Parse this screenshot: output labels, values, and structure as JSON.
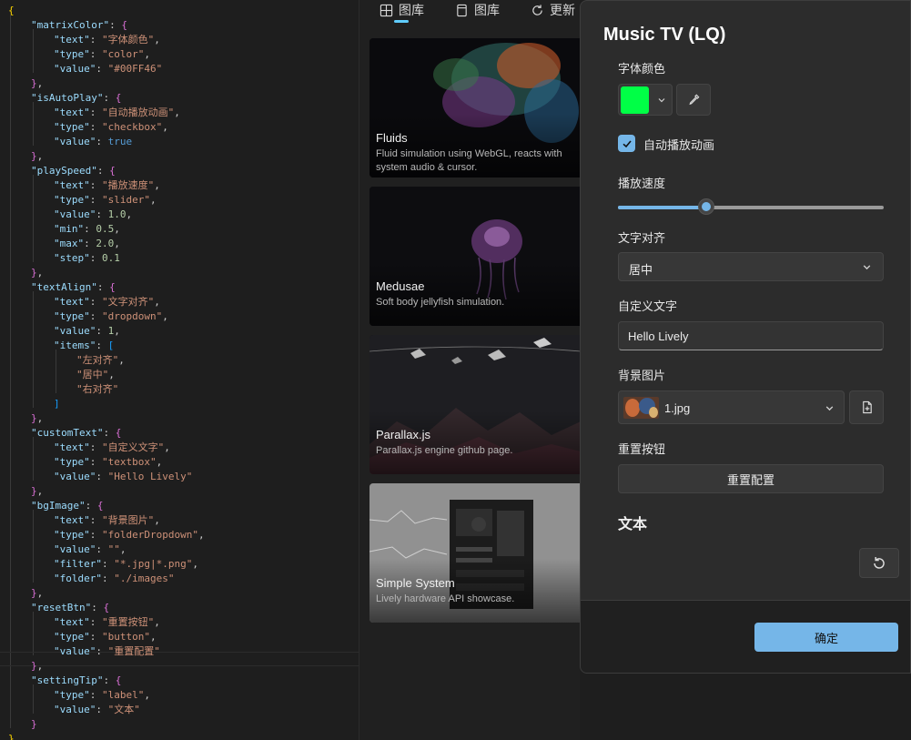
{
  "code": {
    "lines": [
      {
        "indent": 0,
        "parts": [
          [
            "br1",
            "{"
          ]
        ]
      },
      {
        "indent": 1,
        "parts": [
          [
            "k",
            "\"matrixColor\""
          ],
          [
            "p",
            ": "
          ],
          [
            "br2",
            "{"
          ]
        ]
      },
      {
        "indent": 2,
        "parts": [
          [
            "k",
            "\"text\""
          ],
          [
            "p",
            ": "
          ],
          [
            "s",
            "\"字体颜色\""
          ],
          [
            "p",
            ","
          ]
        ]
      },
      {
        "indent": 2,
        "parts": [
          [
            "k",
            "\"type\""
          ],
          [
            "p",
            ": "
          ],
          [
            "s",
            "\"color\""
          ],
          [
            "p",
            ","
          ]
        ]
      },
      {
        "indent": 2,
        "parts": [
          [
            "k",
            "\"value\""
          ],
          [
            "p",
            ": "
          ],
          [
            "s",
            "\"#00FF46\""
          ]
        ]
      },
      {
        "indent": 1,
        "parts": [
          [
            "br2",
            "}"
          ],
          [
            "p",
            ","
          ]
        ]
      },
      {
        "indent": 1,
        "parts": [
          [
            "k",
            "\"isAutoPlay\""
          ],
          [
            "p",
            ": "
          ],
          [
            "br2",
            "{"
          ]
        ]
      },
      {
        "indent": 2,
        "parts": [
          [
            "k",
            "\"text\""
          ],
          [
            "p",
            ": "
          ],
          [
            "s",
            "\"自动播放动画\""
          ],
          [
            "p",
            ","
          ]
        ]
      },
      {
        "indent": 2,
        "parts": [
          [
            "k",
            "\"type\""
          ],
          [
            "p",
            ": "
          ],
          [
            "s",
            "\"checkbox\""
          ],
          [
            "p",
            ","
          ]
        ]
      },
      {
        "indent": 2,
        "parts": [
          [
            "k",
            "\"value\""
          ],
          [
            "p",
            ": "
          ],
          [
            "b",
            "true"
          ]
        ]
      },
      {
        "indent": 1,
        "parts": [
          [
            "br2",
            "}"
          ],
          [
            "p",
            ","
          ]
        ]
      },
      {
        "indent": 1,
        "parts": [
          [
            "k",
            "\"playSpeed\""
          ],
          [
            "p",
            ": "
          ],
          [
            "br2",
            "{"
          ]
        ]
      },
      {
        "indent": 2,
        "parts": [
          [
            "k",
            "\"text\""
          ],
          [
            "p",
            ": "
          ],
          [
            "s",
            "\"播放速度\""
          ],
          [
            "p",
            ","
          ]
        ]
      },
      {
        "indent": 2,
        "parts": [
          [
            "k",
            "\"type\""
          ],
          [
            "p",
            ": "
          ],
          [
            "s",
            "\"slider\""
          ],
          [
            "p",
            ","
          ]
        ]
      },
      {
        "indent": 2,
        "parts": [
          [
            "k",
            "\"value\""
          ],
          [
            "p",
            ": "
          ],
          [
            "n",
            "1.0"
          ],
          [
            "p",
            ","
          ]
        ]
      },
      {
        "indent": 2,
        "parts": [
          [
            "k",
            "\"min\""
          ],
          [
            "p",
            ": "
          ],
          [
            "n",
            "0.5"
          ],
          [
            "p",
            ","
          ]
        ]
      },
      {
        "indent": 2,
        "parts": [
          [
            "k",
            "\"max\""
          ],
          [
            "p",
            ": "
          ],
          [
            "n",
            "2.0"
          ],
          [
            "p",
            ","
          ]
        ]
      },
      {
        "indent": 2,
        "parts": [
          [
            "k",
            "\"step\""
          ],
          [
            "p",
            ": "
          ],
          [
            "n",
            "0.1"
          ]
        ]
      },
      {
        "indent": 1,
        "parts": [
          [
            "br2",
            "}"
          ],
          [
            "p",
            ","
          ]
        ]
      },
      {
        "indent": 1,
        "parts": [
          [
            "k",
            "\"textAlign\""
          ],
          [
            "p",
            ": "
          ],
          [
            "br2",
            "{"
          ]
        ]
      },
      {
        "indent": 2,
        "parts": [
          [
            "k",
            "\"text\""
          ],
          [
            "p",
            ": "
          ],
          [
            "s",
            "\"文字对齐\""
          ],
          [
            "p",
            ","
          ]
        ]
      },
      {
        "indent": 2,
        "parts": [
          [
            "k",
            "\"type\""
          ],
          [
            "p",
            ": "
          ],
          [
            "s",
            "\"dropdown\""
          ],
          [
            "p",
            ","
          ]
        ]
      },
      {
        "indent": 2,
        "parts": [
          [
            "k",
            "\"value\""
          ],
          [
            "p",
            ": "
          ],
          [
            "n",
            "1"
          ],
          [
            "p",
            ","
          ]
        ]
      },
      {
        "indent": 2,
        "parts": [
          [
            "k",
            "\"items\""
          ],
          [
            "p",
            ": "
          ],
          [
            "br3",
            "["
          ]
        ]
      },
      {
        "indent": 3,
        "parts": [
          [
            "s",
            "\"左对齐\""
          ],
          [
            "p",
            ","
          ]
        ]
      },
      {
        "indent": 3,
        "parts": [
          [
            "s",
            "\"居中\""
          ],
          [
            "p",
            ","
          ]
        ]
      },
      {
        "indent": 3,
        "parts": [
          [
            "s",
            "\"右对齐\""
          ]
        ]
      },
      {
        "indent": 2,
        "parts": [
          [
            "br3",
            "]"
          ]
        ]
      },
      {
        "indent": 1,
        "parts": [
          [
            "br2",
            "}"
          ],
          [
            "p",
            ","
          ]
        ]
      },
      {
        "indent": 1,
        "parts": [
          [
            "k",
            "\"customText\""
          ],
          [
            "p",
            ": "
          ],
          [
            "br2",
            "{"
          ]
        ]
      },
      {
        "indent": 2,
        "parts": [
          [
            "k",
            "\"text\""
          ],
          [
            "p",
            ": "
          ],
          [
            "s",
            "\"自定义文字\""
          ],
          [
            "p",
            ","
          ]
        ]
      },
      {
        "indent": 2,
        "parts": [
          [
            "k",
            "\"type\""
          ],
          [
            "p",
            ": "
          ],
          [
            "s",
            "\"textbox\""
          ],
          [
            "p",
            ","
          ]
        ]
      },
      {
        "indent": 2,
        "parts": [
          [
            "k",
            "\"value\""
          ],
          [
            "p",
            ": "
          ],
          [
            "s",
            "\"Hello Lively\""
          ]
        ]
      },
      {
        "indent": 1,
        "parts": [
          [
            "br2",
            "}"
          ],
          [
            "p",
            ","
          ]
        ]
      },
      {
        "indent": 1,
        "parts": [
          [
            "k",
            "\"bgImage\""
          ],
          [
            "p",
            ": "
          ],
          [
            "br2",
            "{"
          ]
        ]
      },
      {
        "indent": 2,
        "parts": [
          [
            "k",
            "\"text\""
          ],
          [
            "p",
            ": "
          ],
          [
            "s",
            "\"背景图片\""
          ],
          [
            "p",
            ","
          ]
        ]
      },
      {
        "indent": 2,
        "parts": [
          [
            "k",
            "\"type\""
          ],
          [
            "p",
            ": "
          ],
          [
            "s",
            "\"folderDropdown\""
          ],
          [
            "p",
            ","
          ]
        ]
      },
      {
        "indent": 2,
        "parts": [
          [
            "k",
            "\"value\""
          ],
          [
            "p",
            ": "
          ],
          [
            "s",
            "\"\""
          ],
          [
            "p",
            ","
          ]
        ]
      },
      {
        "indent": 2,
        "parts": [
          [
            "k",
            "\"filter\""
          ],
          [
            "p",
            ": "
          ],
          [
            "s",
            "\"*.jpg|*.png\""
          ],
          [
            "p",
            ","
          ]
        ]
      },
      {
        "indent": 2,
        "parts": [
          [
            "k",
            "\"folder\""
          ],
          [
            "p",
            ": "
          ],
          [
            "s",
            "\"./images\""
          ]
        ]
      },
      {
        "indent": 1,
        "parts": [
          [
            "br2",
            "}"
          ],
          [
            "p",
            ","
          ]
        ]
      },
      {
        "indent": 1,
        "parts": [
          [
            "k",
            "\"resetBtn\""
          ],
          [
            "p",
            ": "
          ],
          [
            "br2",
            "{"
          ]
        ]
      },
      {
        "indent": 2,
        "parts": [
          [
            "k",
            "\"text\""
          ],
          [
            "p",
            ": "
          ],
          [
            "s",
            "\"重置按钮\""
          ],
          [
            "p",
            ","
          ]
        ]
      },
      {
        "indent": 2,
        "parts": [
          [
            "k",
            "\"type\""
          ],
          [
            "p",
            ": "
          ],
          [
            "s",
            "\"button\""
          ],
          [
            "p",
            ","
          ]
        ]
      },
      {
        "indent": 2,
        "parts": [
          [
            "k",
            "\"value\""
          ],
          [
            "p",
            ": "
          ],
          [
            "s",
            "\"重置配置\""
          ]
        ]
      },
      {
        "indent": 1,
        "parts": [
          [
            "br2",
            "}"
          ],
          [
            "p",
            ","
          ]
        ]
      },
      {
        "indent": 1,
        "parts": [
          [
            "k",
            "\"settingTip\""
          ],
          [
            "p",
            ": "
          ],
          [
            "br2",
            "{"
          ]
        ]
      },
      {
        "indent": 2,
        "parts": [
          [
            "k",
            "\"type\""
          ],
          [
            "p",
            ": "
          ],
          [
            "s",
            "\"label\""
          ],
          [
            "p",
            ","
          ]
        ]
      },
      {
        "indent": 2,
        "parts": [
          [
            "k",
            "\"value\""
          ],
          [
            "p",
            ": "
          ],
          [
            "s",
            "\"文本\""
          ]
        ]
      },
      {
        "indent": 1,
        "parts": [
          [
            "br2",
            "}"
          ]
        ]
      },
      {
        "indent": 0,
        "parts": [
          [
            "br1",
            "}"
          ]
        ]
      }
    ]
  },
  "gallery": {
    "tabs": [
      {
        "label": "图库",
        "icon": "gallery-icon"
      },
      {
        "label": "图库",
        "icon": "wallpaper-icon"
      },
      {
        "label": "更新",
        "icon": "refresh-icon"
      }
    ],
    "cards": [
      {
        "title": "Fluids",
        "desc": "Fluid simulation using WebGL, reacts with system audio & cursor."
      },
      {
        "title": "Medusae",
        "desc": "Soft body jellyfish simulation."
      },
      {
        "title": "Parallax.js",
        "desc": "Parallax.js engine github page."
      },
      {
        "title": "Simple System",
        "desc": "Lively hardware API showcase."
      }
    ]
  },
  "panel": {
    "title": "Music TV (LQ)",
    "color_label": "字体颜色",
    "color_value": "#00FF46",
    "autoplay_label": "自动播放动画",
    "autoplay_checked": true,
    "speed_label": "播放速度",
    "speed_value": 1.0,
    "speed_min": 0.5,
    "speed_max": 2.0,
    "align_label": "文字对齐",
    "align_value": "居中",
    "text_label": "自定义文字",
    "text_value": "Hello Lively",
    "bg_label": "背景图片",
    "bg_value": "1.jpg",
    "reset_label": "重置按钮",
    "reset_button": "重置配置",
    "tip_label": "文本",
    "ok_button": "确定",
    "accent": "#75B6E8"
  }
}
